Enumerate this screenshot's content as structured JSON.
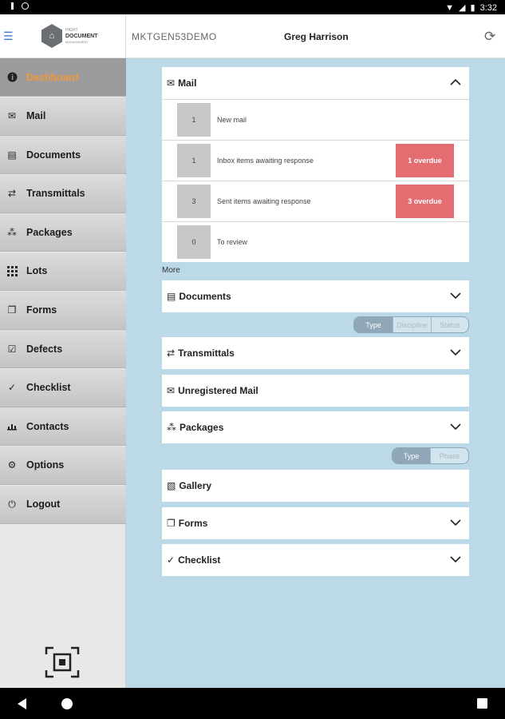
{
  "status_bar": {
    "time": "3:32"
  },
  "header": {
    "logo": {
      "line1": "HIGHT",
      "line2": "DOCUMENT",
      "line3": "MANAGEMENT"
    },
    "project": "MKTGEN53DEMO",
    "user": "Greg Harrison"
  },
  "sidebar": {
    "items": [
      {
        "label": "Dashboard",
        "icon": "info-icon",
        "active": true
      },
      {
        "label": "Mail",
        "icon": "envelope-icon"
      },
      {
        "label": "Documents",
        "icon": "document-icon"
      },
      {
        "label": "Transmittals",
        "icon": "transmittal-arrows-icon"
      },
      {
        "label": "Packages",
        "icon": "package-icon"
      },
      {
        "label": "Lots",
        "icon": "grid-icon"
      },
      {
        "label": "Forms",
        "icon": "forms-icon"
      },
      {
        "label": "Defects",
        "icon": "defects-icon"
      },
      {
        "label": "Checklist",
        "icon": "checklist-icon"
      },
      {
        "label": "Contacts",
        "icon": "contacts-chart-icon"
      },
      {
        "label": "Options",
        "icon": "gear-icon"
      },
      {
        "label": "Logout",
        "icon": "power-icon"
      }
    ]
  },
  "dashboard": {
    "mail": {
      "title": "Mail",
      "rows": [
        {
          "count": "1",
          "label": "New mail",
          "overdue": ""
        },
        {
          "count": "1",
          "label": "Inbox items awaiting response",
          "overdue": "1 overdue"
        },
        {
          "count": "3",
          "label": "Sent items awaiting response",
          "overdue": "3 overdue"
        },
        {
          "count": "0",
          "label": "To review",
          "overdue": ""
        }
      ],
      "more": "More"
    },
    "documents": {
      "title": "Documents",
      "segments": [
        "Type",
        "Discipline",
        "Status"
      ]
    },
    "transmittals": {
      "title": "Transmittals"
    },
    "unregistered_mail": {
      "title": "Unregistered Mail"
    },
    "packages": {
      "title": "Packages",
      "segments": [
        "Type",
        "Phase"
      ]
    },
    "gallery": {
      "title": "Gallery"
    },
    "forms": {
      "title": "Forms"
    },
    "checklist": {
      "title": "Checklist"
    }
  }
}
